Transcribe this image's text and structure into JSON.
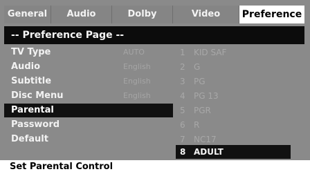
{
  "tabs": [
    {
      "label": "General"
    },
    {
      "label": "Audio"
    },
    {
      "label": "Dolby"
    },
    {
      "label": "Video"
    },
    {
      "label": "Preference",
      "active": true
    }
  ],
  "page_header": "-- Preference Page --",
  "settings": [
    {
      "label": "TV Type",
      "value": "AUTO"
    },
    {
      "label": "Audio",
      "value": "English"
    },
    {
      "label": "Subtitle",
      "value": "English"
    },
    {
      "label": "Disc Menu",
      "value": "English"
    },
    {
      "label": "Parental",
      "value": "",
      "selected": true
    },
    {
      "label": "Password",
      "value": ""
    },
    {
      "label": "Default",
      "value": ""
    }
  ],
  "parental_options": [
    {
      "num": "1",
      "label": "KID SAF"
    },
    {
      "num": "2",
      "label": "G"
    },
    {
      "num": "3",
      "label": "PG"
    },
    {
      "num": "4",
      "label": "PG 13"
    },
    {
      "num": "5",
      "label": "PGR"
    },
    {
      "num": "6",
      "label": "R"
    },
    {
      "num": "7",
      "label": "NC17"
    },
    {
      "num": "8",
      "label": "ADULT",
      "selected": true
    }
  ],
  "status_text": "Set Parental Control",
  "colors": {
    "panel": "#8a8a8a",
    "highlight": "#111111",
    "active_tab": "#ffffff"
  }
}
